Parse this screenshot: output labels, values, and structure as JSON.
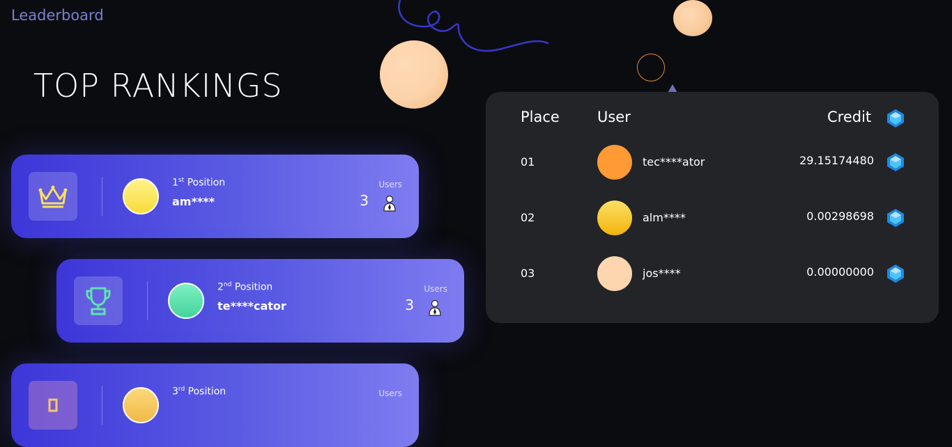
{
  "app": {
    "title": "Leaderboard"
  },
  "page": {
    "heading": "TOP RANKINGS"
  },
  "colors": {
    "accent": "#7b7fd1",
    "card_gradient_start": "#3d36d9",
    "card_gradient_end": "#7f7cf0",
    "board_bg": "#232428"
  },
  "rank_cards": [
    {
      "ordinal_num": "1",
      "ordinal_suffix": "st",
      "position_word": "Position",
      "username": "am****",
      "users_label": "Users",
      "users_count": "3",
      "avatar_color": "#fbe55a",
      "icon": "crown-icon"
    },
    {
      "ordinal_num": "2",
      "ordinal_suffix": "nd",
      "position_word": "Position",
      "username": "te****cator",
      "users_label": "Users",
      "users_count": "3",
      "avatar_color": "#5ee3b0",
      "icon": "trophy-icon"
    },
    {
      "ordinal_num": "3",
      "ordinal_suffix": "rd",
      "position_word": "Position",
      "username": "",
      "users_label": "Users",
      "users_count": "",
      "avatar_color": "#f5c86a",
      "icon": "medal-icon"
    }
  ],
  "leaderboard": {
    "headers": {
      "place": "Place",
      "user": "User",
      "credit": "Credit"
    },
    "credit_icon": "gem-icon",
    "rows": [
      {
        "place": "01",
        "user": "tec****ator",
        "credit": "29.15174480",
        "avatar_color": "#ff9a35"
      },
      {
        "place": "02",
        "user": "alm****",
        "credit": "0.00298698",
        "avatar_color": "#f8c825"
      },
      {
        "place": "03",
        "user": "jos****",
        "credit": "0.00000000",
        "avatar_color": "#fdd6b0"
      }
    ]
  }
}
